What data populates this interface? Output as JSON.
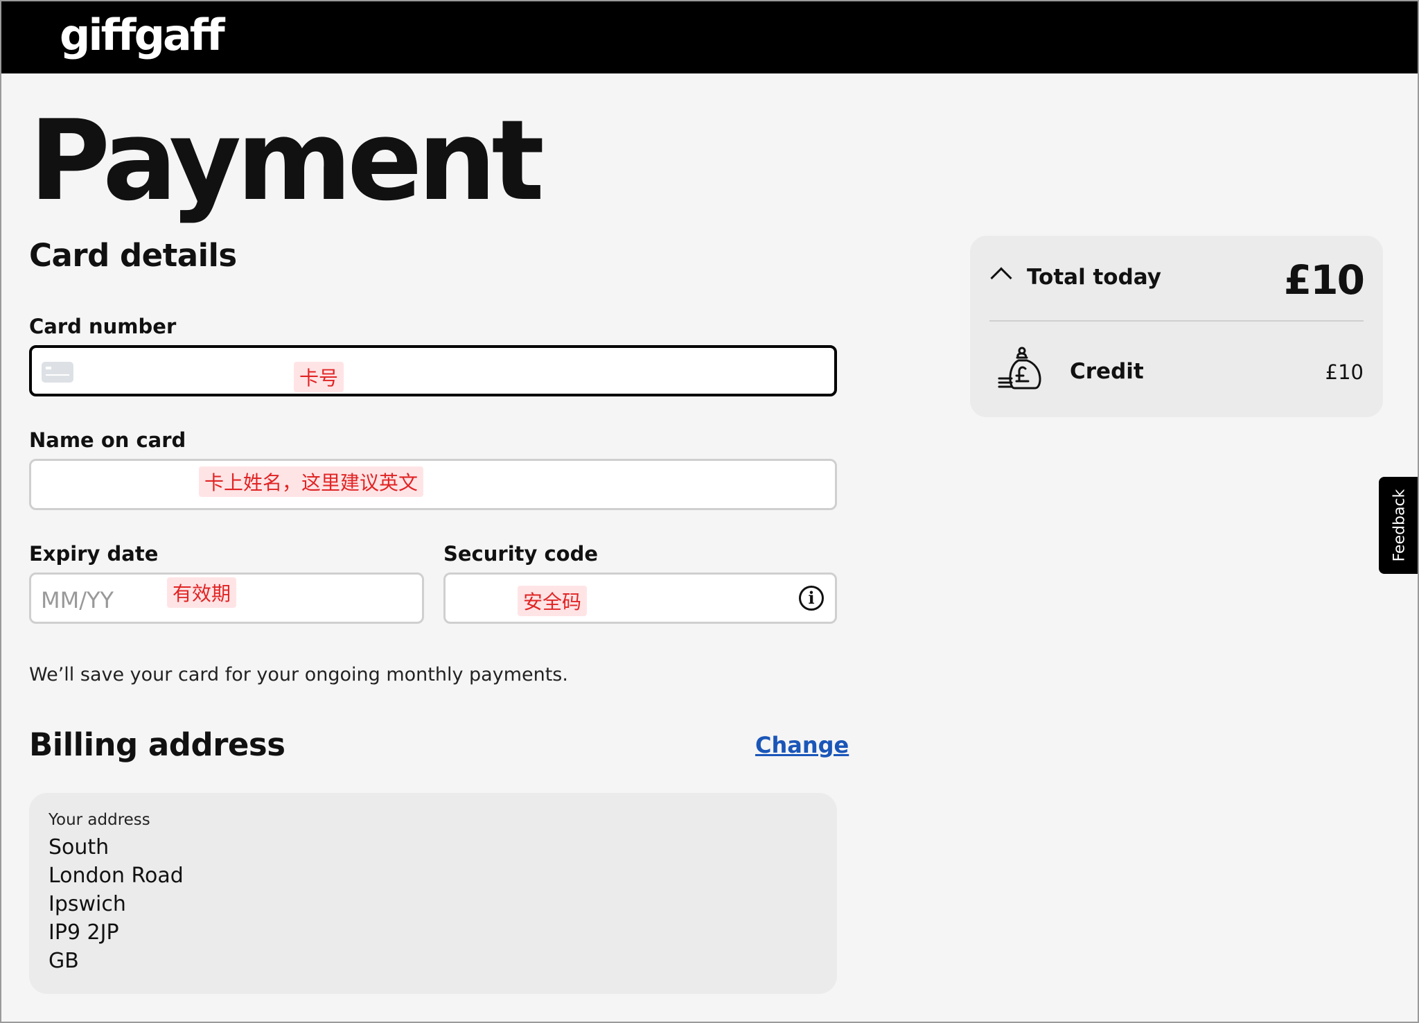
{
  "header": {
    "logo": "giffgaff"
  },
  "page": {
    "title": "Payment"
  },
  "card_details": {
    "title": "Card details",
    "card_number": {
      "label": "Card number",
      "note": "卡号"
    },
    "name_on_card": {
      "label": "Name on card",
      "note": "卡上姓名，这里建议英文"
    },
    "expiry": {
      "label": "Expiry date",
      "placeholder": "MM/YY",
      "note": "有效期"
    },
    "security": {
      "label": "Security code",
      "note": "安全码",
      "info_glyph": "i"
    }
  },
  "save_note": "We’ll save your card for your ongoing monthly payments.",
  "billing": {
    "title": "Billing address",
    "change_label": "Change",
    "address_label": "Your address",
    "lines": [
      "South",
      "London Road",
      "Ipswich",
      "IP9 2JP",
      "GB"
    ]
  },
  "summary": {
    "total_label": "Total today",
    "total_value": "£10",
    "credit_label": "Credit",
    "credit_value": "£10"
  },
  "feedback": {
    "label": "Feedback"
  },
  "colors": {
    "accent_link": "#1a56b8",
    "annotation_red": "#e02424",
    "header_bg": "#000000"
  },
  "icons": [
    "chevron-up-icon",
    "money-bag-icon",
    "info-icon",
    "card-icon"
  ]
}
